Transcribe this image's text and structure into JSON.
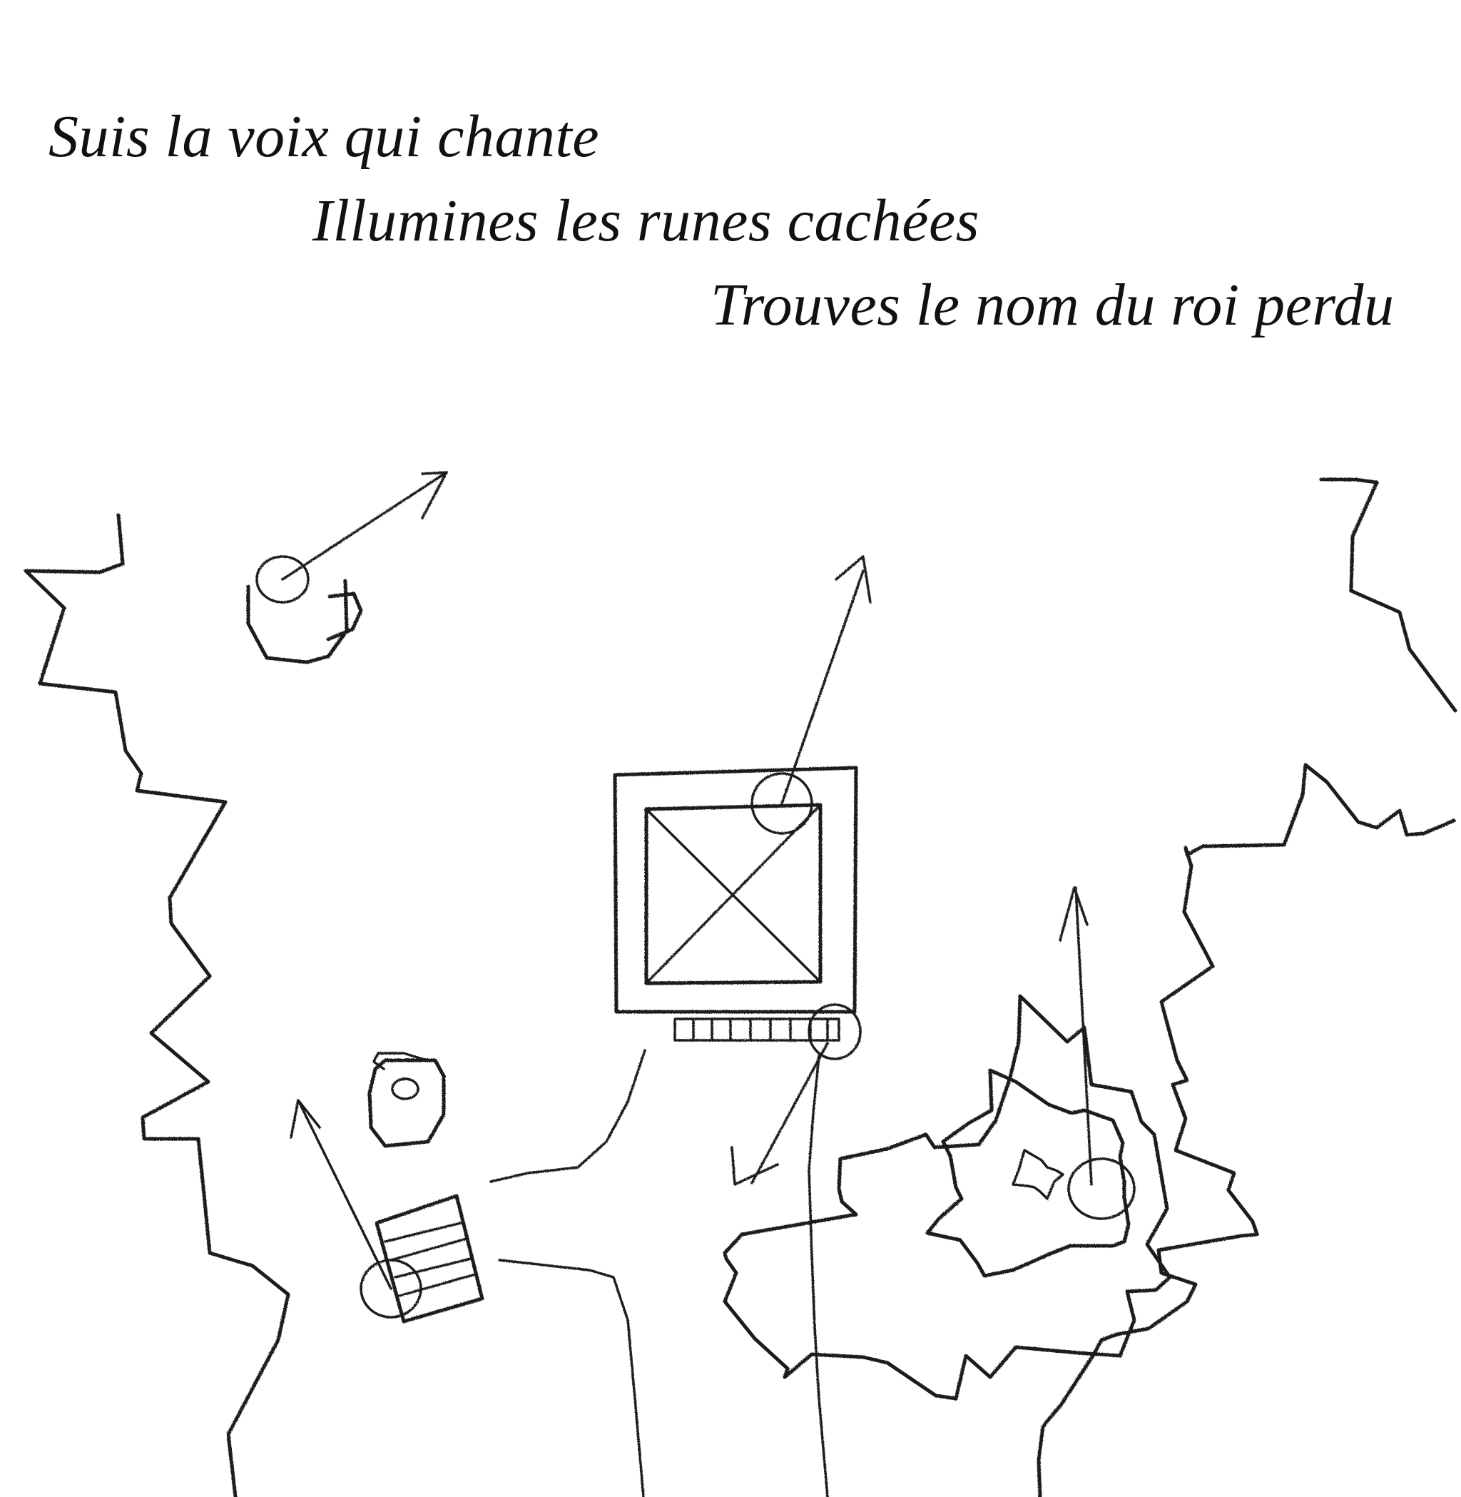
{
  "riddle": {
    "line_1": "Suis la voix qui chante",
    "line_2": "Illumines les runes cachées",
    "line_3": "Trouves le nom du roi perdu"
  },
  "colors": {
    "ink": "#1a1a1a",
    "paper": "#ffffff"
  }
}
